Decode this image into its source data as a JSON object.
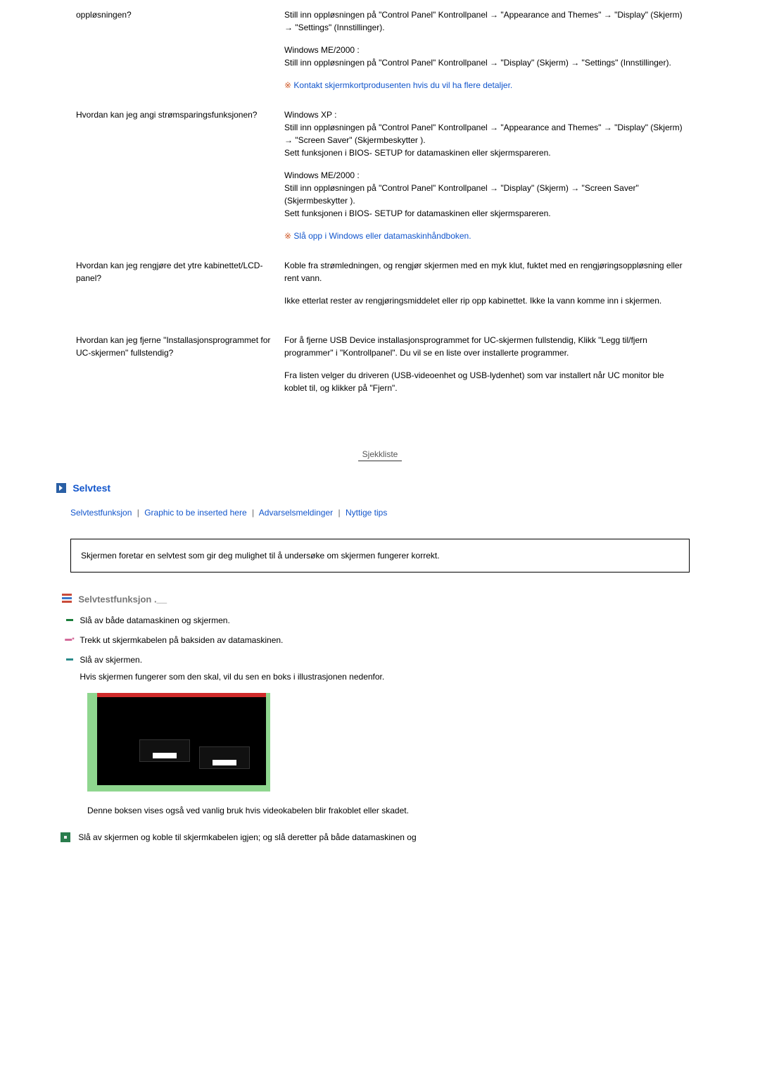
{
  "faq": [
    {
      "q": "oppløsningen?",
      "a": [
        "Still inn oppløsningen på \"Control Panel\" Kontrollpanel → \"Appearance and Themes\" → \"Display\" (Skjerm) → \"Settings\" (Innstillinger).",
        "Windows ME/2000 :\nStill inn oppløsningen på \"Control Panel\" Kontrollpanel → \"Display\" (Skjerm) → \"Settings\" (Innstillinger)."
      ],
      "note": "Kontakt skjermkortprodusenten hvis du vil ha flere detaljer."
    },
    {
      "q": "Hvordan kan jeg angi strømsparingsfunksjonen?",
      "a": [
        "Windows XP :\nStill inn oppløsningen på \"Control Panel\" Kontrollpanel → \"Appearance and Themes\" → \"Display\" (Skjerm) → \"Screen Saver\" (Skjermbeskytter ).\nSett funksjonen i BIOS- SETUP for datamaskinen eller skjermspareren.",
        "Windows ME/2000 :\nStill inn oppløsningen på \"Control Panel\" Kontrollpanel → \"Display\" (Skjerm) → \"Screen Saver\" (Skjermbeskytter ).\nSett funksjonen i BIOS- SETUP for datamaskinen eller skjermspareren."
      ],
      "note": "Slå opp i Windows eller datamaskinhåndboken."
    },
    {
      "q": "Hvordan kan jeg rengjøre det ytre kabinettet/LCD-panel?",
      "a": [
        "Koble fra strømledningen, og rengjør skjermen med en myk klut, fuktet med en rengjøringsoppløsning eller rent vann.",
        "Ikke etterlat rester av rengjøringsmiddelet eller rip opp kabinettet. Ikke la vann komme inn i skjermen."
      ],
      "note": null
    },
    {
      "q": "Hvordan kan jeg fjerne \"Installasjonsprogrammet for UC-skjermen\" fullstendig?",
      "a": [
        "For å fjerne USB Device installasjonsprogrammet for UC-skjermen fullstendig, Klikk \"Legg til/fjern programmer\" i \"Kontrollpanel\". Du vil se en liste over installerte programmer.",
        "Fra listen velger du driveren (USB-videoenhet og USB-lydenhet) som var installert når UC monitor ble koblet til, og klikker på \"Fjern\"."
      ],
      "note": null
    }
  ],
  "sjekkliste_label": "Sjekkliste",
  "selvtest": {
    "title": "Selvtest",
    "links": [
      "Selvtestfunksjon",
      "Graphic to be inserted here",
      "Advarselsmeldinger",
      "Nyttige tips"
    ],
    "infobox": "Skjermen foretar en selvtest som gir deg mulighet til å undersøke om skjermen fungerer korrekt.",
    "subhead": "Selvtestfunksjon",
    "steps": [
      {
        "icon": "green",
        "text": "Slå av både datamaskinen og skjermen."
      },
      {
        "icon": "pink",
        "text": "Trekk ut skjermkabelen på baksiden av datamaskinen."
      },
      {
        "icon": "teal",
        "text": "Slå av skjermen.",
        "second": "Hvis skjermen fungerer som den skal, vil du sen en boks i illustrasjonen nedenfor."
      }
    ],
    "caption": "Denne boksen vises også ved vanlig bruk hvis videokabelen blir frakoblet eller skadet.",
    "final": "Slå av skjermen og koble til skjermkabelen igjen; og slå deretter på både datamaskinen og"
  }
}
